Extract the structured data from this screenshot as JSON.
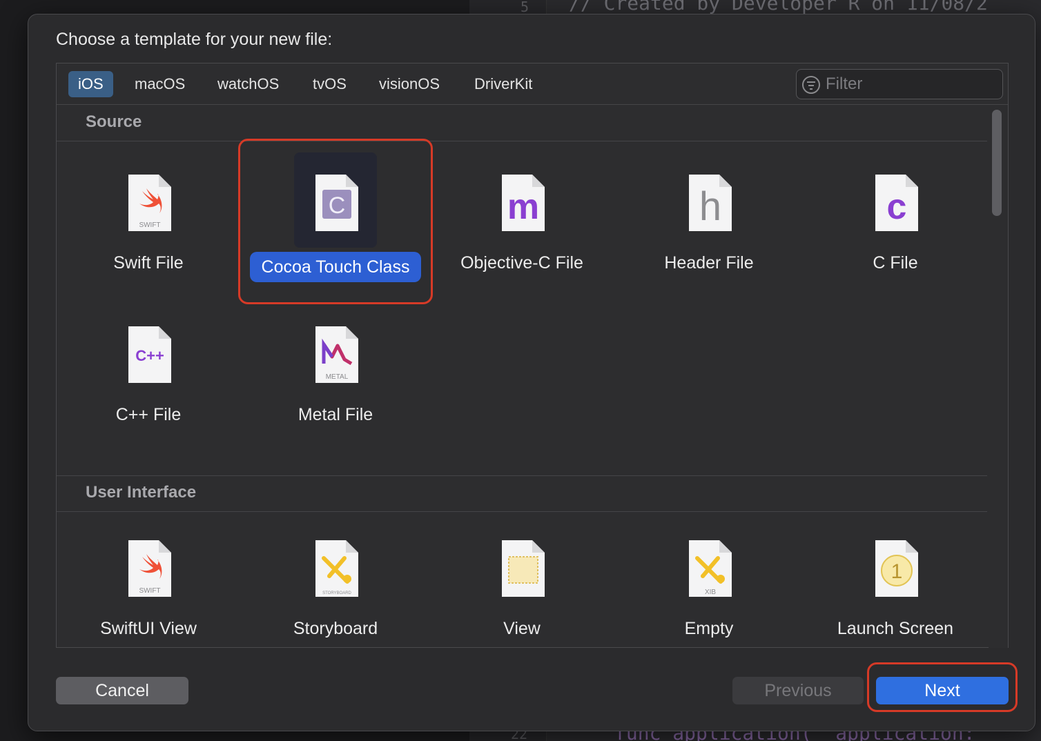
{
  "dialog": {
    "title": "Choose a template for your new file:",
    "filter_placeholder": "Filter",
    "tabs": [
      {
        "label": "iOS",
        "active": true
      },
      {
        "label": "macOS",
        "active": false
      },
      {
        "label": "watchOS",
        "active": false
      },
      {
        "label": "tvOS",
        "active": false
      },
      {
        "label": "visionOS",
        "active": false
      },
      {
        "label": "DriverKit",
        "active": false
      }
    ],
    "sections": {
      "source": {
        "heading": "Source",
        "items": [
          {
            "label": "Swift File",
            "icon": "swift-icon",
            "badge": "SWIFT"
          },
          {
            "label": "Cocoa Touch Class",
            "icon": "cocoa-class-icon",
            "badge": "C",
            "selected": true
          },
          {
            "label": "Objective-C File",
            "icon": "objc-m-icon",
            "badge": "m"
          },
          {
            "label": "Header File",
            "icon": "header-h-icon",
            "badge": "h"
          },
          {
            "label": "C File",
            "icon": "c-file-icon",
            "badge": "c"
          },
          {
            "label": "C++ File",
            "icon": "cpp-icon",
            "badge": "C++"
          },
          {
            "label": "Metal File",
            "icon": "metal-icon",
            "badge": "METAL"
          }
        ]
      },
      "user_interface": {
        "heading": "User Interface",
        "items": [
          {
            "label": "SwiftUI View",
            "icon": "swift-icon",
            "badge": "SWIFT"
          },
          {
            "label": "Storyboard",
            "icon": "storyboard-icon",
            "badge": "STORYBOARD"
          },
          {
            "label": "View",
            "icon": "view-xib-icon",
            "badge": ""
          },
          {
            "label": "Empty",
            "icon": "xib-icon",
            "badge": "XIB"
          },
          {
            "label": "Launch Screen",
            "icon": "launch-screen-icon",
            "badge": "1"
          }
        ]
      }
    },
    "buttons": {
      "cancel": "Cancel",
      "previous": "Previous",
      "next": "Next"
    }
  },
  "background_editor": {
    "line_top": "5",
    "code_top": "//  Created by Developer R on 11/08/2",
    "line_bottom": "22",
    "code_bottom": "func application(_ application:"
  },
  "colors": {
    "accent": "#2d5fd3",
    "next_button": "#2f6fe0",
    "highlight_outline": "#d63a27",
    "tab_active": "#3a5f86"
  }
}
